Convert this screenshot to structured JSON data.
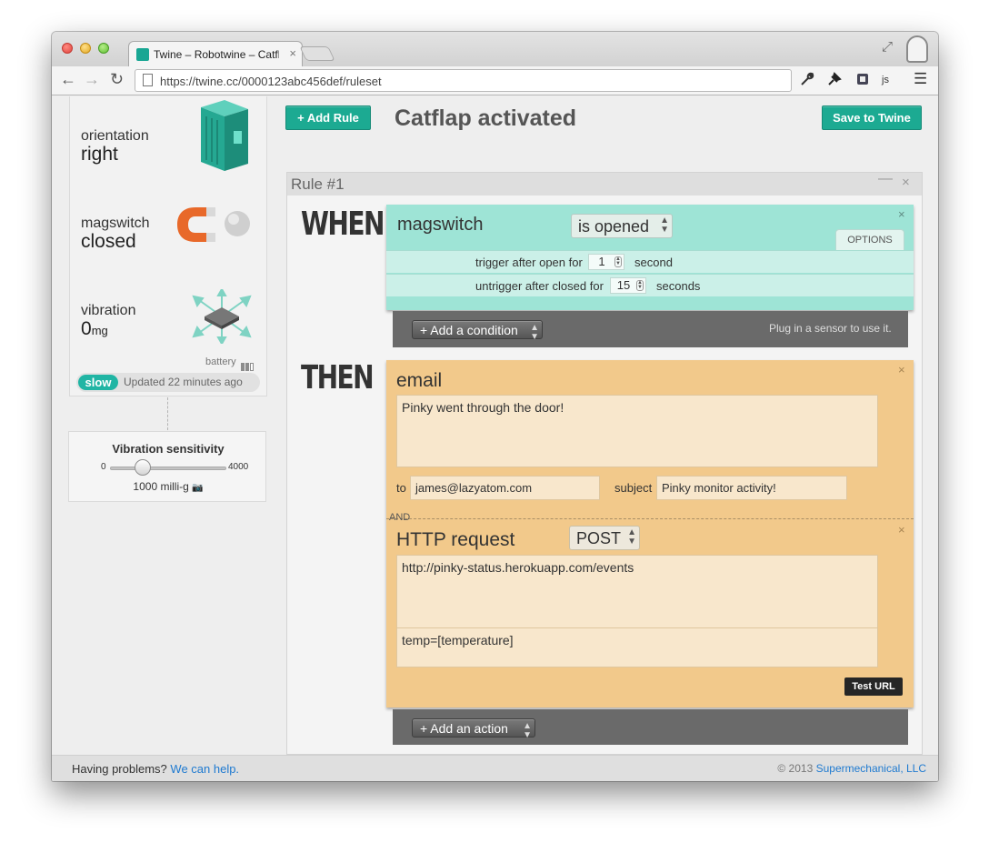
{
  "browser": {
    "tab_title": "Twine – Robotwine – Catfl",
    "tab_close": "×",
    "url": "https://twine.cc/0000123abc456def/ruleset",
    "js_label": "js"
  },
  "device": {
    "orientation": {
      "label": "orientation",
      "value": "right"
    },
    "magswitch": {
      "label": "magswitch",
      "value": "closed"
    },
    "vibration": {
      "label": "vibration",
      "value": "0",
      "unit": "mg"
    },
    "battery_label": "battery",
    "battery_level": 0.66,
    "speed_badge": "slow",
    "updated_text": "Updated 22 minutes ago"
  },
  "sensitivity": {
    "title": "Vibration sensitivity",
    "min": "0",
    "max": "4000",
    "value": 1000,
    "value_text": "1000 milli-g"
  },
  "toolbar": {
    "add_rule_label": "+ Add Rule",
    "save_label": "Save to Twine",
    "ruleset_title": "Catflap activated"
  },
  "rule": {
    "name": "Rule #1",
    "minimize": "—",
    "close": "×",
    "when_label": "WHEN",
    "then_label": "THEN",
    "condition": {
      "sensor": "magswitch",
      "state": "is opened",
      "close": "×",
      "options_label": "OPTIONS",
      "trigger_label": "trigger after open for",
      "trigger_value": "1",
      "trigger_unit": "second",
      "untrigger_label": "untrigger after closed for",
      "untrigger_value": "15",
      "untrigger_unit": "seconds"
    },
    "add_condition_label": "+ Add a condition",
    "plug_hint": "Plug in a sensor to use it.",
    "actions": {
      "email": {
        "title": "email",
        "body": "Pinky went through the door!",
        "to_label": "to",
        "to_value": "james@lazyatom.com",
        "subject_label": "subject",
        "subject_value": "Pinky monitor activity!",
        "close": "×"
      },
      "and_label": "AND",
      "http": {
        "title": "HTTP request",
        "method": "POST",
        "url": "http://pinky-status.herokuapp.com/events",
        "params": "temp=[temperature]",
        "test_label": "Test URL",
        "close": "×"
      }
    },
    "add_action_label": "+ Add an action"
  },
  "footer": {
    "problem_text": "Having problems?",
    "help_link": "We can help.",
    "copyright": "© 2013",
    "company_link": "Supermechanical, LLC"
  },
  "colors": {
    "brand_teal": "#1caa92",
    "condition_bg": "#9ee4d6",
    "action_bg": "#f2c98b",
    "magnet_orange": "#e8692a"
  }
}
